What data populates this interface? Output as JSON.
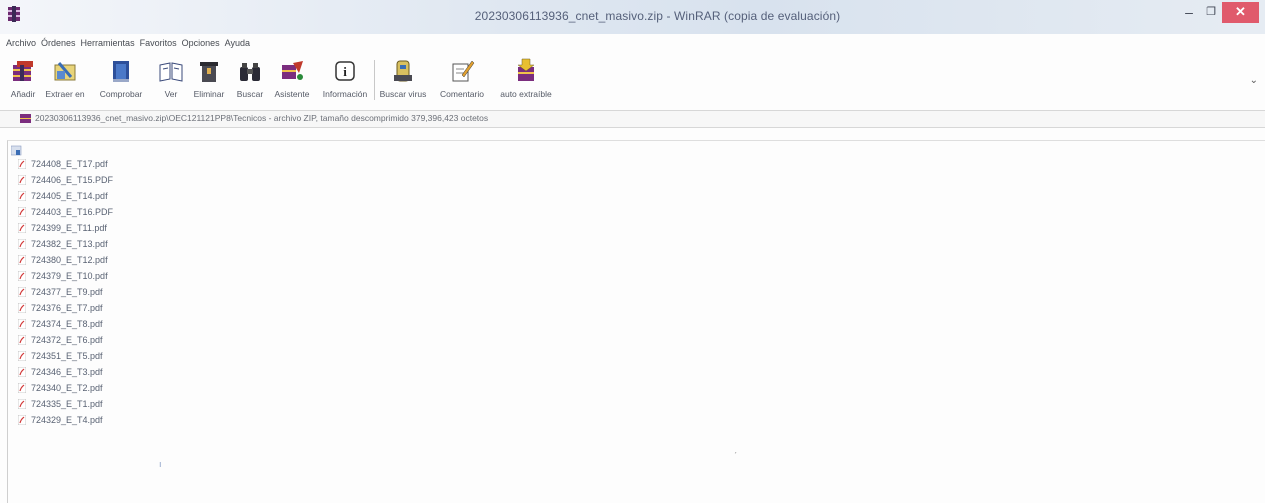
{
  "window": {
    "title": "20230306113936_cnet_masivo.zip - WinRAR (copia de evaluación)",
    "controls": {
      "minimize": "–",
      "maximize": "❐",
      "close": "✕"
    }
  },
  "menu": [
    "Archivo",
    "Órdenes",
    "Herramientas",
    "Favoritos",
    "Opciones",
    "Ayuda"
  ],
  "toolbar": {
    "add": "Añadir",
    "extract": "Extraer en",
    "test": "Comprobar",
    "view": "Ver",
    "delete": "Eliminar",
    "find": "Buscar",
    "wizard": "Asistente",
    "info": "Información",
    "virus": "Buscar virus",
    "comment": "Comentario",
    "sfx": "auto extraíble",
    "overflow": "⌄"
  },
  "address": {
    "path": "20230306113936_cnet_masivo.zip\\OEC121121PP8\\Tecnicos - archivo ZIP, tamaño descomprimido 379,396,423 octetos"
  },
  "files": [
    "724408_E_T17.pdf",
    "724406_E_T15.PDF",
    "724405_E_T14.pdf",
    "724403_E_T16.PDF",
    "724399_E_T11.pdf",
    "724382_E_T13.pdf",
    "724380_E_T12.pdf",
    "724379_E_T10.pdf",
    "724377_E_T9.pdf",
    "724376_E_T7.pdf",
    "724374_E_T8.pdf",
    "724372_E_T6.pdf",
    "724351_E_T5.pdf",
    "724346_E_T3.pdf",
    "724340_E_T2.pdf",
    "724335_E_T1.pdf",
    "724329_E_T4.pdf"
  ],
  "colors": {
    "titlebar": "#dfe7f1",
    "close_button": "#e05a6c",
    "pdf_icon": "#d23a3a"
  }
}
